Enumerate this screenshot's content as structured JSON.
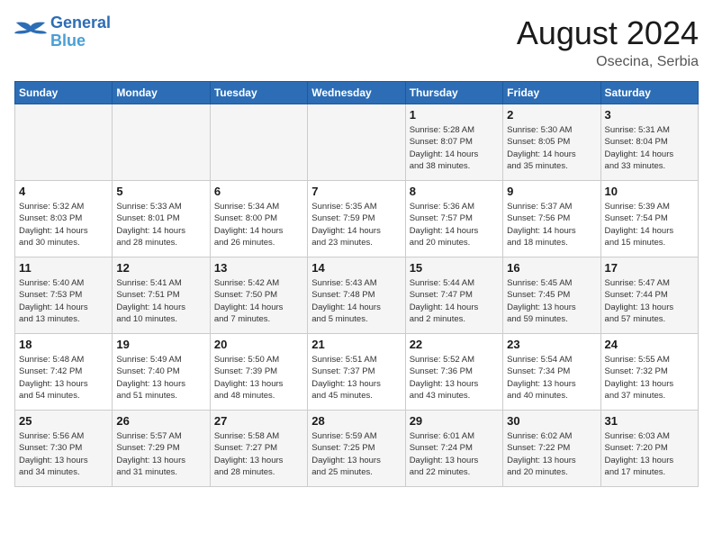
{
  "header": {
    "logo_line1": "General",
    "logo_line2": "Blue",
    "month_year": "August 2024",
    "location": "Osecina, Serbia"
  },
  "days_of_week": [
    "Sunday",
    "Monday",
    "Tuesday",
    "Wednesday",
    "Thursday",
    "Friday",
    "Saturday"
  ],
  "weeks": [
    [
      {
        "day": "",
        "info": ""
      },
      {
        "day": "",
        "info": ""
      },
      {
        "day": "",
        "info": ""
      },
      {
        "day": "",
        "info": ""
      },
      {
        "day": "1",
        "info": "Sunrise: 5:28 AM\nSunset: 8:07 PM\nDaylight: 14 hours\nand 38 minutes."
      },
      {
        "day": "2",
        "info": "Sunrise: 5:30 AM\nSunset: 8:05 PM\nDaylight: 14 hours\nand 35 minutes."
      },
      {
        "day": "3",
        "info": "Sunrise: 5:31 AM\nSunset: 8:04 PM\nDaylight: 14 hours\nand 33 minutes."
      }
    ],
    [
      {
        "day": "4",
        "info": "Sunrise: 5:32 AM\nSunset: 8:03 PM\nDaylight: 14 hours\nand 30 minutes."
      },
      {
        "day": "5",
        "info": "Sunrise: 5:33 AM\nSunset: 8:01 PM\nDaylight: 14 hours\nand 28 minutes."
      },
      {
        "day": "6",
        "info": "Sunrise: 5:34 AM\nSunset: 8:00 PM\nDaylight: 14 hours\nand 26 minutes."
      },
      {
        "day": "7",
        "info": "Sunrise: 5:35 AM\nSunset: 7:59 PM\nDaylight: 14 hours\nand 23 minutes."
      },
      {
        "day": "8",
        "info": "Sunrise: 5:36 AM\nSunset: 7:57 PM\nDaylight: 14 hours\nand 20 minutes."
      },
      {
        "day": "9",
        "info": "Sunrise: 5:37 AM\nSunset: 7:56 PM\nDaylight: 14 hours\nand 18 minutes."
      },
      {
        "day": "10",
        "info": "Sunrise: 5:39 AM\nSunset: 7:54 PM\nDaylight: 14 hours\nand 15 minutes."
      }
    ],
    [
      {
        "day": "11",
        "info": "Sunrise: 5:40 AM\nSunset: 7:53 PM\nDaylight: 14 hours\nand 13 minutes."
      },
      {
        "day": "12",
        "info": "Sunrise: 5:41 AM\nSunset: 7:51 PM\nDaylight: 14 hours\nand 10 minutes."
      },
      {
        "day": "13",
        "info": "Sunrise: 5:42 AM\nSunset: 7:50 PM\nDaylight: 14 hours\nand 7 minutes."
      },
      {
        "day": "14",
        "info": "Sunrise: 5:43 AM\nSunset: 7:48 PM\nDaylight: 14 hours\nand 5 minutes."
      },
      {
        "day": "15",
        "info": "Sunrise: 5:44 AM\nSunset: 7:47 PM\nDaylight: 14 hours\nand 2 minutes."
      },
      {
        "day": "16",
        "info": "Sunrise: 5:45 AM\nSunset: 7:45 PM\nDaylight: 13 hours\nand 59 minutes."
      },
      {
        "day": "17",
        "info": "Sunrise: 5:47 AM\nSunset: 7:44 PM\nDaylight: 13 hours\nand 57 minutes."
      }
    ],
    [
      {
        "day": "18",
        "info": "Sunrise: 5:48 AM\nSunset: 7:42 PM\nDaylight: 13 hours\nand 54 minutes."
      },
      {
        "day": "19",
        "info": "Sunrise: 5:49 AM\nSunset: 7:40 PM\nDaylight: 13 hours\nand 51 minutes."
      },
      {
        "day": "20",
        "info": "Sunrise: 5:50 AM\nSunset: 7:39 PM\nDaylight: 13 hours\nand 48 minutes."
      },
      {
        "day": "21",
        "info": "Sunrise: 5:51 AM\nSunset: 7:37 PM\nDaylight: 13 hours\nand 45 minutes."
      },
      {
        "day": "22",
        "info": "Sunrise: 5:52 AM\nSunset: 7:36 PM\nDaylight: 13 hours\nand 43 minutes."
      },
      {
        "day": "23",
        "info": "Sunrise: 5:54 AM\nSunset: 7:34 PM\nDaylight: 13 hours\nand 40 minutes."
      },
      {
        "day": "24",
        "info": "Sunrise: 5:55 AM\nSunset: 7:32 PM\nDaylight: 13 hours\nand 37 minutes."
      }
    ],
    [
      {
        "day": "25",
        "info": "Sunrise: 5:56 AM\nSunset: 7:30 PM\nDaylight: 13 hours\nand 34 minutes."
      },
      {
        "day": "26",
        "info": "Sunrise: 5:57 AM\nSunset: 7:29 PM\nDaylight: 13 hours\nand 31 minutes."
      },
      {
        "day": "27",
        "info": "Sunrise: 5:58 AM\nSunset: 7:27 PM\nDaylight: 13 hours\nand 28 minutes."
      },
      {
        "day": "28",
        "info": "Sunrise: 5:59 AM\nSunset: 7:25 PM\nDaylight: 13 hours\nand 25 minutes."
      },
      {
        "day": "29",
        "info": "Sunrise: 6:01 AM\nSunset: 7:24 PM\nDaylight: 13 hours\nand 22 minutes."
      },
      {
        "day": "30",
        "info": "Sunrise: 6:02 AM\nSunset: 7:22 PM\nDaylight: 13 hours\nand 20 minutes."
      },
      {
        "day": "31",
        "info": "Sunrise: 6:03 AM\nSunset: 7:20 PM\nDaylight: 13 hours\nand 17 minutes."
      }
    ]
  ]
}
